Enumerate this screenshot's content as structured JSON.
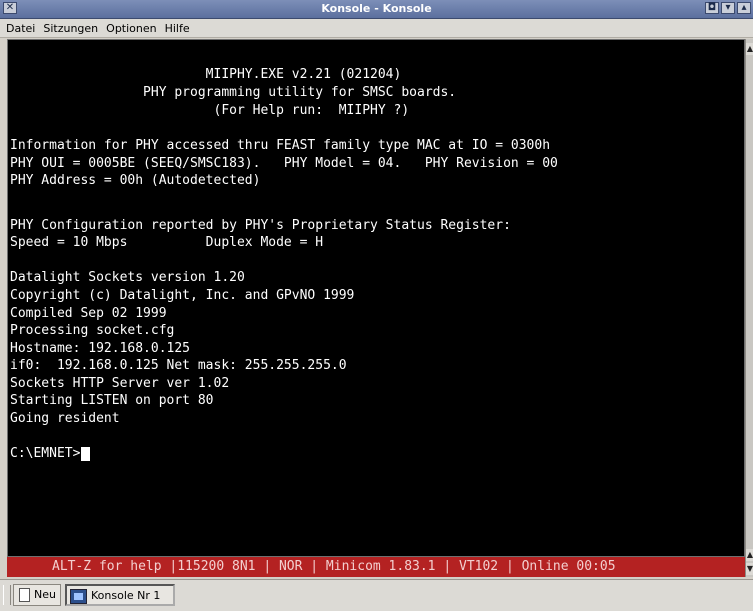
{
  "window": {
    "title": "Konsole - Konsole",
    "close_glyph": "✕",
    "max_glyph": "◘",
    "min_glyph": "▾",
    "pin_glyph": "▴"
  },
  "menu": {
    "items": [
      "Datei",
      "Sitzungen",
      "Optionen",
      "Hilfe"
    ]
  },
  "terminal": {
    "lines": [
      "                         MIIPHY.EXE v2.21 (021204)",
      "                 PHY programming utility for SMSC boards.",
      "                          (For Help run:  MIIPHY ?)",
      "",
      "Information for PHY accessed thru FEAST family type MAC at IO = 0300h",
      "PHY OUI = 0005BE (SEEQ/SMSC183).   PHY Model = 04.   PHY Revision = 00",
      "PHY Address = 00h (Autodetected)",
      "",
      "PHY Configuration reported by PHY's Proprietary Status Register:",
      "Speed = 10 Mbps          Duplex Mode = H",
      "",
      "Datalight Sockets version 1.20",
      "Copyright (c) Datalight, Inc. and GPvNO 1999",
      "Compiled Sep 02 1999",
      "Processing socket.cfg",
      "Hostname: 192.168.0.125",
      "if0:  192.168.0.125 Net mask: 255.255.255.0",
      "Sockets HTTP Server ver 1.02",
      "Starting LISTEN on port 80",
      "Going resident",
      ""
    ],
    "prompt": "C:\\EMNET>"
  },
  "status_bar": {
    "text": "ALT-Z for help |115200 8N1 | NOR | Minicom 1.83.1 | VT102 | Online 00:05"
  },
  "taskbar": {
    "new_label": "Neu",
    "task_label": "Konsole Nr 1"
  },
  "colors": {
    "terminal_bg": "#000000",
    "terminal_fg": "#ffffff",
    "status_bg": "#b42222",
    "titlebar": "#5b6f9e"
  },
  "icons": {
    "close": "close-icon",
    "new_session": "document-icon",
    "konsole": "konsole-icon"
  }
}
